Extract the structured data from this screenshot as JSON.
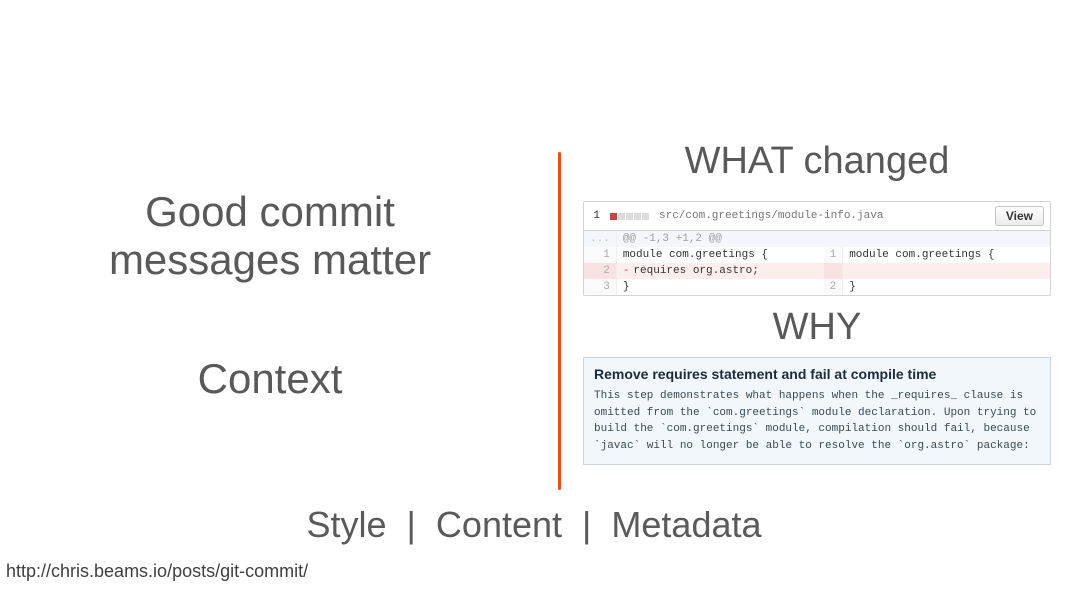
{
  "left": {
    "heading_line1": "Good commit",
    "heading_line2": "messages matter",
    "subheading": "Context"
  },
  "right": {
    "what_label": "WHAT changed",
    "why_label": "WHY"
  },
  "diff": {
    "file_index": "1",
    "path": "src/com.greetings/module-info.java",
    "view_button": "View",
    "hunk": "@@ -1,3 +1,2 @@",
    "rows": [
      {
        "old_ln": "1",
        "old_code": "module com.greetings {",
        "new_ln": "1",
        "new_code": "module com.greetings {",
        "type": "ctx"
      },
      {
        "old_ln": "2",
        "old_code": "requires org.astro;",
        "new_ln": "",
        "new_code": "",
        "type": "del"
      },
      {
        "old_ln": "3",
        "old_code": "}",
        "new_ln": "2",
        "new_code": "}",
        "type": "ctx"
      }
    ]
  },
  "commit_msg": {
    "title": "Remove requires statement and fail at compile time",
    "body": "This step demonstrates what happens when the _requires_ clause is omitted from the `com.greetings` module declaration. Upon trying to build the `com.greetings` module, compilation should fail, because `javac` will no longer be able to resolve the `org.astro` package:"
  },
  "bottom": {
    "items": [
      "Style",
      "Content",
      "Metadata"
    ],
    "separator": "|"
  },
  "source_url": "http://chris.beams.io/posts/git-commit/"
}
